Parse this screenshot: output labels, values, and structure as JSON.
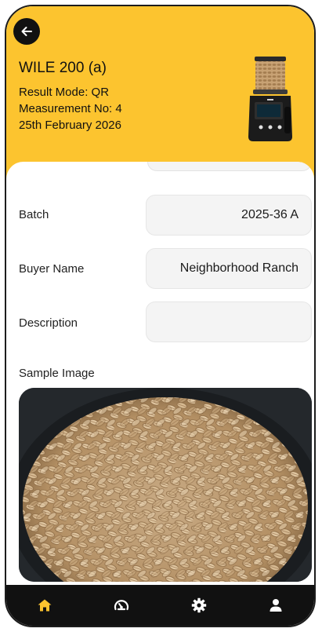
{
  "header": {
    "device_name": "WILE 200 (a)",
    "result_mode": "Result Mode: QR",
    "measurement_no": "Measurement No: 4",
    "date": "25th February 2026"
  },
  "form": {
    "batch_label": "Batch",
    "batch_value": "2025-36 A",
    "buyer_label": "Buyer Name",
    "buyer_value": "Neighborhood Ranch",
    "description_label": "Description",
    "description_value": "",
    "sample_image_label": "Sample Image"
  },
  "nav": {
    "items": [
      {
        "icon": "home-icon",
        "active": true
      },
      {
        "icon": "gauge-icon",
        "active": false
      },
      {
        "icon": "gear-icon",
        "active": false
      },
      {
        "icon": "user-icon",
        "active": false
      }
    ]
  },
  "colors": {
    "header_bg": "#fcc42f",
    "nav_bg": "#111111",
    "nav_active": "#fcc42f",
    "nav_inactive": "#ffffff"
  }
}
